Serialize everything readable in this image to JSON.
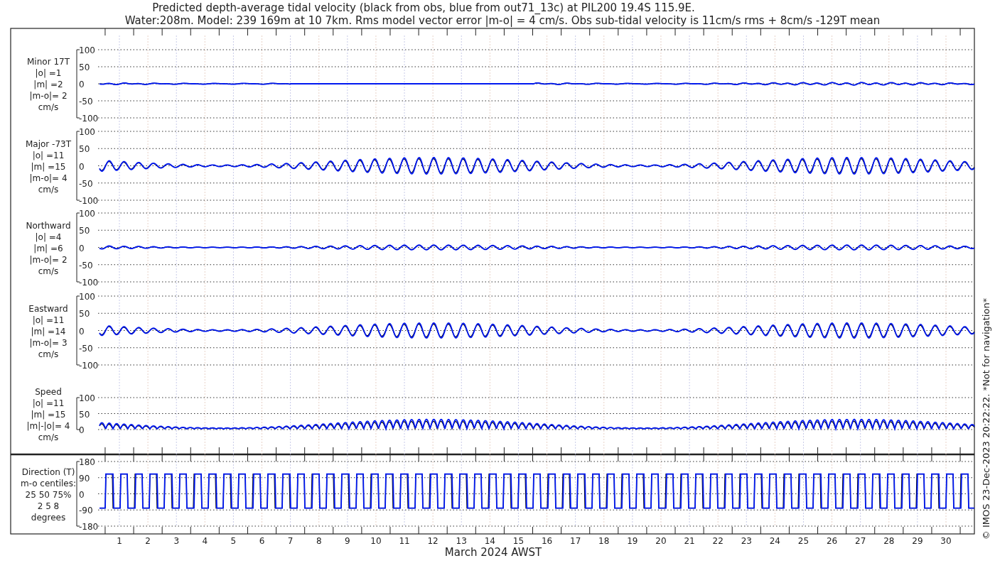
{
  "title_lines": [
    "Predicted depth-average tidal velocity (black from obs, blue from out71_13c) at PIL200 19.4S 115.9E.",
    "Water:208m. Model: 239 169m at 10 7km. Rms model vector error |m-o| = 4 cm/s. Obs sub-tidal velocity is 11cm/s rms + 8cm/s -129T mean"
  ],
  "panels": [
    {
      "kind": "velocity",
      "label_lines": [
        "Minor 17T",
        "|o| =1",
        "|m| =2",
        "|m-o|= 2",
        "cm/s"
      ],
      "yticks": [
        "100",
        "50",
        "0",
        "-50",
        "-100"
      ]
    },
    {
      "kind": "velocity",
      "label_lines": [
        "Major -73T",
        "|o| =11",
        "|m| =15",
        "|m-o|= 4",
        "cm/s"
      ],
      "yticks": [
        "100",
        "50",
        "0",
        "-50",
        "-100"
      ]
    },
    {
      "kind": "velocity",
      "label_lines": [
        "Northward",
        "|o| =4",
        "|m| =6",
        "|m-o|= 2",
        "cm/s"
      ],
      "yticks": [
        "100",
        "50",
        "0",
        "-50",
        "-100"
      ]
    },
    {
      "kind": "velocity",
      "label_lines": [
        "Eastward",
        "|o| =11",
        "|m| =14",
        "|m-o|= 3",
        "cm/s"
      ],
      "yticks": [
        "100",
        "50",
        "0",
        "-50",
        "-100"
      ]
    },
    {
      "kind": "speed",
      "label_lines": [
        "Speed",
        "|o| =11",
        "|m| =15",
        "|m|-|o|= 4",
        "cm/s"
      ],
      "yticks": [
        "100",
        "50",
        "0"
      ]
    },
    {
      "kind": "direction",
      "label_lines": [
        "Direction (T)",
        "m-o centiles:",
        "25  50  75%",
        "2  5  8",
        "degrees"
      ],
      "yticks": [
        "180",
        "90",
        "0",
        "-90",
        "-180"
      ]
    }
  ],
  "xticks": [
    "1",
    "2",
    "3",
    "4",
    "5",
    "6",
    "7",
    "8",
    "9",
    "10",
    "11",
    "12",
    "13",
    "14",
    "15",
    "16",
    "17",
    "18",
    "19",
    "20",
    "21",
    "22",
    "23",
    "24",
    "25",
    "26",
    "27",
    "28",
    "29",
    "30"
  ],
  "xlabel": "March 2024 AWST",
  "credit": "© IMOS 23-Dec-2023 20:22:22. *Not for navigation*"
}
